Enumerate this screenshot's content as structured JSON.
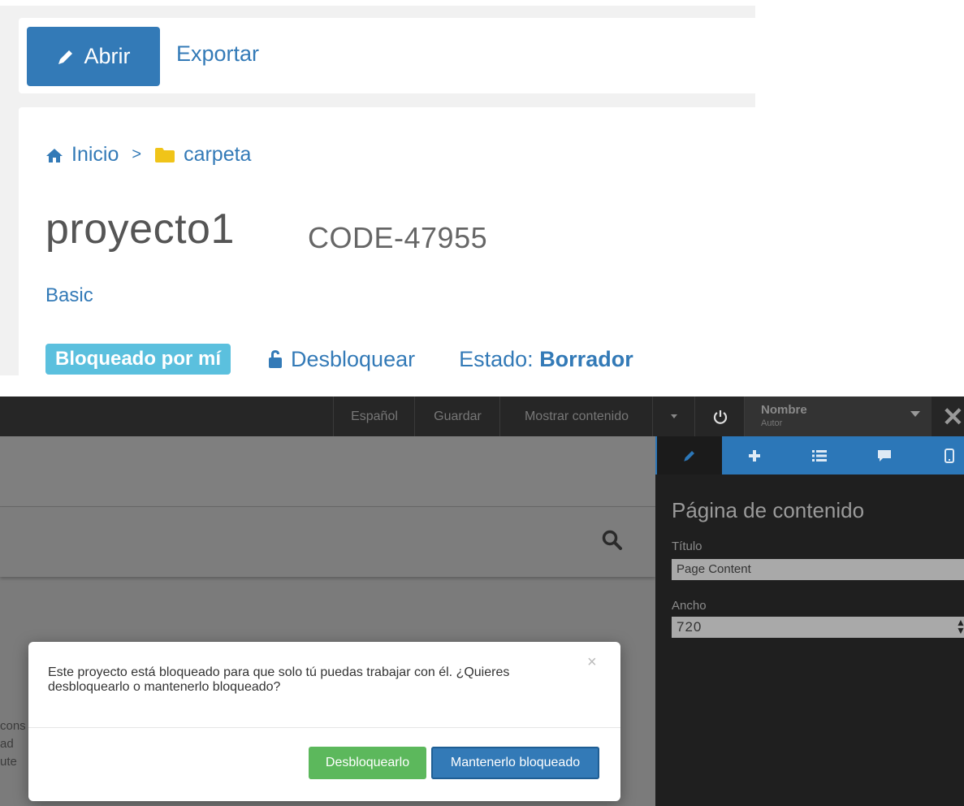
{
  "toolbar": {
    "open_label": "Abrir",
    "export_label": "Exportar"
  },
  "breadcrumb": {
    "home_label": "Inicio",
    "separator": ">",
    "folder_label": "carpeta"
  },
  "project": {
    "title": "proyecto1",
    "code": "CODE-47955",
    "plan": "Basic"
  },
  "lock": {
    "badge": "Bloqueado por mí",
    "unlock_label": "Desbloquear",
    "status_label": "Estado:",
    "status_value": "Borrador"
  },
  "editor": {
    "topbar": {
      "language": "Español",
      "save": "Guardar",
      "show_content": "Mostrar contenido",
      "user_name": "Nombre",
      "user_role": "Autor"
    },
    "canvas_text": [
      "cons",
      "ad",
      "ute"
    ],
    "sidebar": {
      "heading": "Página de contenido",
      "title_label": "Título",
      "title_value": "Page Content",
      "width_label": "Ancho",
      "width_value": "720"
    }
  },
  "dialog": {
    "message": "Este proyecto está bloqueado para que solo tú puedas trabajar con él. ¿Quieres desbloquearlo o mantenerlo bloqueado?",
    "close_symbol": "×",
    "unlock_button": "Desbloquearlo",
    "keep_button": "Mantenerlo bloqueado"
  },
  "colors": {
    "primary": "#337ab7",
    "info": "#5bc0de",
    "success": "#5cb85c",
    "topbar": "#262626",
    "sidebar": "#1f1f1f"
  },
  "icons": [
    "pencil-icon",
    "home-icon",
    "folder-icon",
    "unlock-icon",
    "search-icon",
    "power-icon",
    "plus-icon",
    "list-icon",
    "comment-icon",
    "mobile-icon",
    "close-icon"
  ]
}
